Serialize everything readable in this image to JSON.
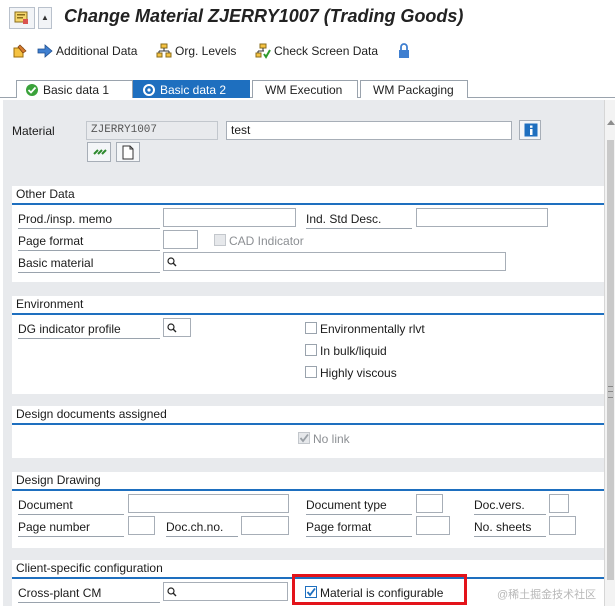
{
  "window": {
    "title": "Change Material ZJERRY1007 (Trading Goods)"
  },
  "toolbar": {
    "additional_data": "Additional Data",
    "org_levels": "Org. Levels",
    "check_screen_data": "Check Screen Data"
  },
  "tabs": [
    {
      "label": "Basic data 1",
      "active": false
    },
    {
      "label": "Basic data 2",
      "active": true
    },
    {
      "label": "WM Execution",
      "active": false
    },
    {
      "label": "WM Packaging",
      "active": false
    }
  ],
  "header": {
    "material_label": "Material",
    "material_value": "ZJERRY1007",
    "description_value": "test"
  },
  "other_data": {
    "title": "Other Data",
    "prod_insp_memo_label": "Prod./insp. memo",
    "prod_insp_memo_value": "",
    "ind_std_desc_label": "Ind. Std Desc.",
    "ind_std_desc_value": "",
    "page_format_label": "Page format",
    "page_format_value": "",
    "cad_indicator_label": "CAD Indicator",
    "basic_material_label": "Basic material",
    "basic_material_value": ""
  },
  "environment": {
    "title": "Environment",
    "dg_indicator_label": "DG indicator profile",
    "environmentally_rlvt_label": "Environmentally rlvt",
    "in_bulk_liquid_label": "In bulk/liquid",
    "highly_viscous_label": "Highly viscous"
  },
  "design_documents": {
    "title": "Design documents assigned",
    "no_link_label": "No link",
    "no_link_checked": true
  },
  "design_drawing": {
    "title": "Design Drawing",
    "document_label": "Document",
    "document_type_label": "Document type",
    "doc_vers_label": "Doc.vers.",
    "page_number_label": "Page number",
    "doc_ch_no_label": "Doc.ch.no.",
    "page_format_label": "Page format",
    "no_sheets_label": "No. sheets"
  },
  "client_config": {
    "title": "Client-specific configuration",
    "cross_plant_cm_label": "Cross-plant CM",
    "material_configurable_label": "Material is configurable",
    "material_configurable_checked": true
  },
  "watermark": "@稀土掘金技术社区",
  "colors": {
    "accent": "#1e6fbf",
    "highlight": "#e3131a",
    "background": "#e8eaed"
  }
}
